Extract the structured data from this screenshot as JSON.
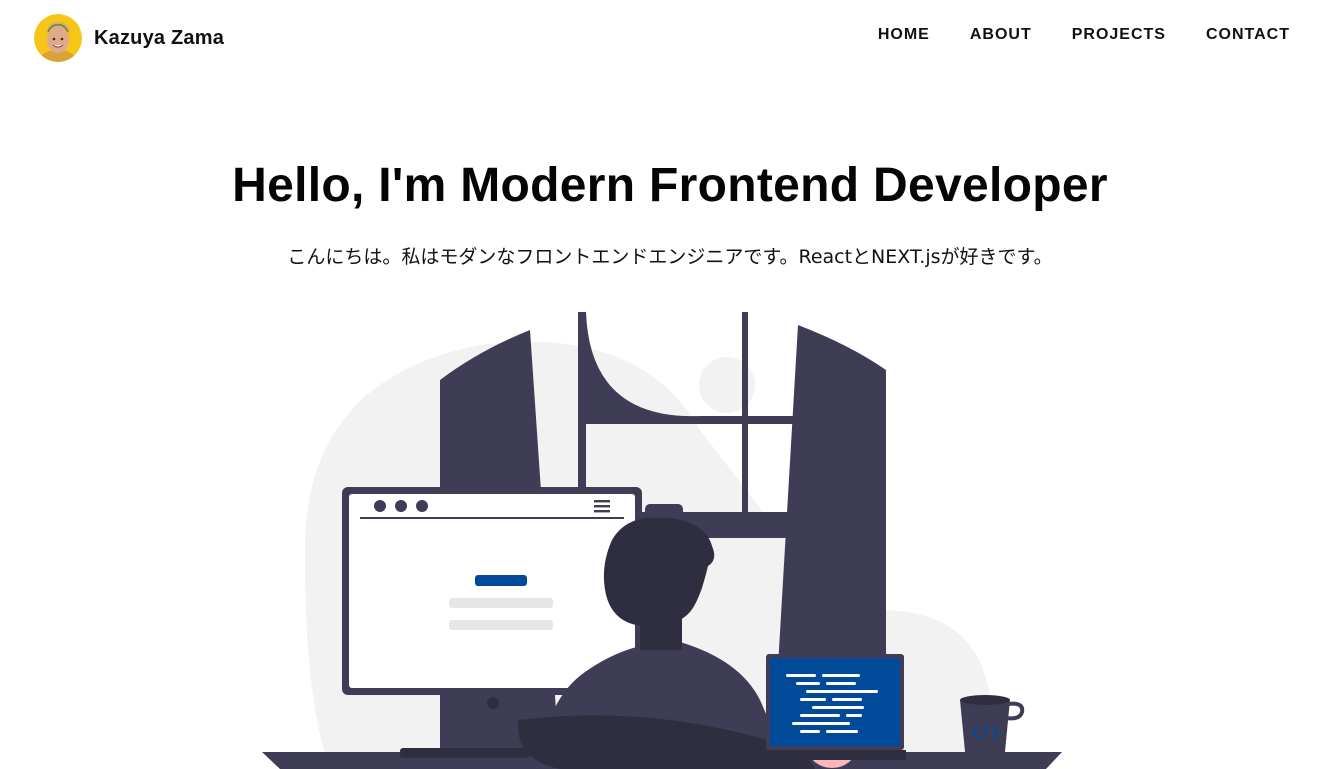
{
  "header": {
    "brand_name": "Kazuya Zama",
    "avatar_icon": "profile-photo",
    "nav": [
      "HOME",
      "ABOUT",
      "PROJECTS",
      "CONTACT"
    ]
  },
  "hero": {
    "title": "Hello, I'm Modern Frontend Developer",
    "subtitle": "こんにちは。私はモダンなフロントエンドエンジニアです。ReactとNEXT.jsが好きです。"
  },
  "illustration": {
    "subject": "developer-at-desk-illustration",
    "colors": {
      "dark": "#3f3d56",
      "hair": "#2f2e41",
      "accent": "#004a99",
      "skin": "#ffb6b6",
      "light_gray": "#f2f2f2",
      "line_gray": "#e6e6e6"
    }
  }
}
